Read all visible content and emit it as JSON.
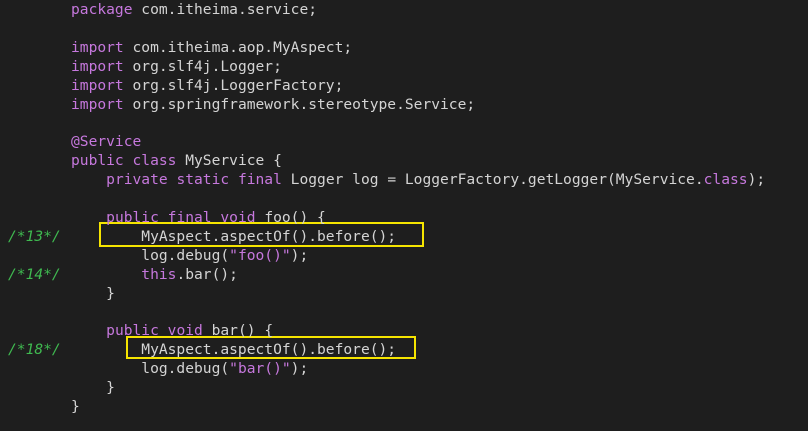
{
  "lines": [
    {
      "tokens": [
        {
          "t": "package",
          "c": "kw"
        },
        {
          "t": " com.itheima.service;",
          "c": "plain"
        }
      ]
    },
    {
      "tokens": []
    },
    {
      "tokens": [
        {
          "t": "import",
          "c": "kw"
        },
        {
          "t": " com.itheima.aop.MyAspect;",
          "c": "plain"
        }
      ]
    },
    {
      "tokens": [
        {
          "t": "import",
          "c": "kw"
        },
        {
          "t": " org.slf4j.Logger;",
          "c": "plain"
        }
      ]
    },
    {
      "tokens": [
        {
          "t": "import",
          "c": "kw"
        },
        {
          "t": " org.slf4j.LoggerFactory;",
          "c": "plain"
        }
      ]
    },
    {
      "tokens": [
        {
          "t": "import",
          "c": "kw"
        },
        {
          "t": " org.springframework.stereotype.Service;",
          "c": "plain"
        }
      ]
    },
    {
      "tokens": []
    },
    {
      "tokens": [
        {
          "t": "@Service",
          "c": "ann"
        }
      ]
    },
    {
      "tokens": [
        {
          "t": "public class",
          "c": "kw"
        },
        {
          "t": " MyService {",
          "c": "plain"
        }
      ]
    },
    {
      "tokens": [
        {
          "t": "    ",
          "c": "plain"
        },
        {
          "t": "private static final",
          "c": "kw"
        },
        {
          "t": " Logger log = LoggerFactory.getLogger(MyService.",
          "c": "plain"
        },
        {
          "t": "class",
          "c": "kw"
        },
        {
          "t": ");",
          "c": "plain"
        }
      ]
    },
    {
      "tokens": []
    },
    {
      "tokens": [
        {
          "t": "    ",
          "c": "plain"
        },
        {
          "t": "public final void",
          "c": "kw"
        },
        {
          "t": " foo() {",
          "c": "plain"
        }
      ]
    },
    {
      "gutter": "/*13*/",
      "tokens": [
        {
          "t": "        MyAspect.aspectOf().before();",
          "c": "plain"
        }
      ]
    },
    {
      "tokens": [
        {
          "t": "        log.debug(",
          "c": "plain"
        },
        {
          "t": "\"foo()\"",
          "c": "str"
        },
        {
          "t": ");",
          "c": "plain"
        }
      ]
    },
    {
      "gutter": "/*14*/",
      "tokens": [
        {
          "t": "        ",
          "c": "plain"
        },
        {
          "t": "this",
          "c": "kw"
        },
        {
          "t": ".bar();",
          "c": "plain"
        }
      ]
    },
    {
      "tokens": [
        {
          "t": "    }",
          "c": "plain"
        }
      ]
    },
    {
      "tokens": []
    },
    {
      "tokens": [
        {
          "t": "    ",
          "c": "plain"
        },
        {
          "t": "public void",
          "c": "kw"
        },
        {
          "t": " bar() {",
          "c": "plain"
        }
      ]
    },
    {
      "gutter": "/*18*/",
      "tokens": [
        {
          "t": "        MyAspect.aspectOf().before();",
          "c": "plain"
        }
      ]
    },
    {
      "tokens": [
        {
          "t": "        log.debug(",
          "c": "plain"
        },
        {
          "t": "\"bar()\"",
          "c": "str"
        },
        {
          "t": ");",
          "c": "plain"
        }
      ]
    },
    {
      "tokens": [
        {
          "t": "    }",
          "c": "plain"
        }
      ]
    },
    {
      "tokens": [
        {
          "t": "}",
          "c": "plain"
        }
      ]
    }
  ],
  "colors": {
    "background": "#1e1e1e",
    "keyword": "#c678dd",
    "text": "#d4d4d4",
    "gutter_comment": "#3fb950",
    "highlight_border": "#f5e400"
  }
}
